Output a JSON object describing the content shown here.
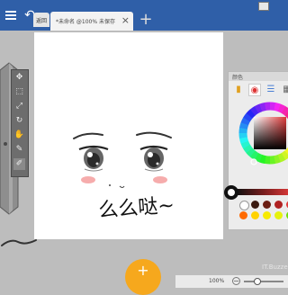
{
  "header": {
    "back_label": "返回",
    "tab_title": "*未命名 @100% 未保存",
    "close_glyph": "×",
    "new_tab_glyph": "+"
  },
  "tools": [
    {
      "icon": "move-icon",
      "glyph": "✥"
    },
    {
      "icon": "select-icon",
      "glyph": "⬚"
    },
    {
      "icon": "transform-icon",
      "glyph": "⤢"
    },
    {
      "icon": "rotate-icon",
      "glyph": "↻"
    },
    {
      "icon": "hand-icon",
      "glyph": "✋"
    },
    {
      "icon": "eyedropper-icon",
      "glyph": "✎"
    },
    {
      "icon": "brush-icon",
      "glyph": "✐"
    }
  ],
  "canvas": {
    "text": "么么哒~"
  },
  "color_panel": {
    "title": "颜色",
    "tabs": [
      {
        "icon": "palette-icon",
        "glyph": "▮"
      },
      {
        "icon": "color-wheel-icon",
        "glyph": "◉"
      },
      {
        "icon": "sliders-icon",
        "glyph": "☰"
      },
      {
        "icon": "swatches-icon",
        "glyph": "▦"
      }
    ],
    "current_color": "#e03a3a",
    "swatches": [
      "#ffffff",
      "#3a1a10",
      "#6b1e12",
      "#b02222",
      "#e03a3a",
      "#ff6a00",
      "#ffd200",
      "#f7ea00",
      "#e6f20d",
      "#70e000"
    ]
  },
  "status": {
    "zoom": "100%",
    "zoom_level": 0.3
  },
  "watermark": "IT.Buzzer"
}
